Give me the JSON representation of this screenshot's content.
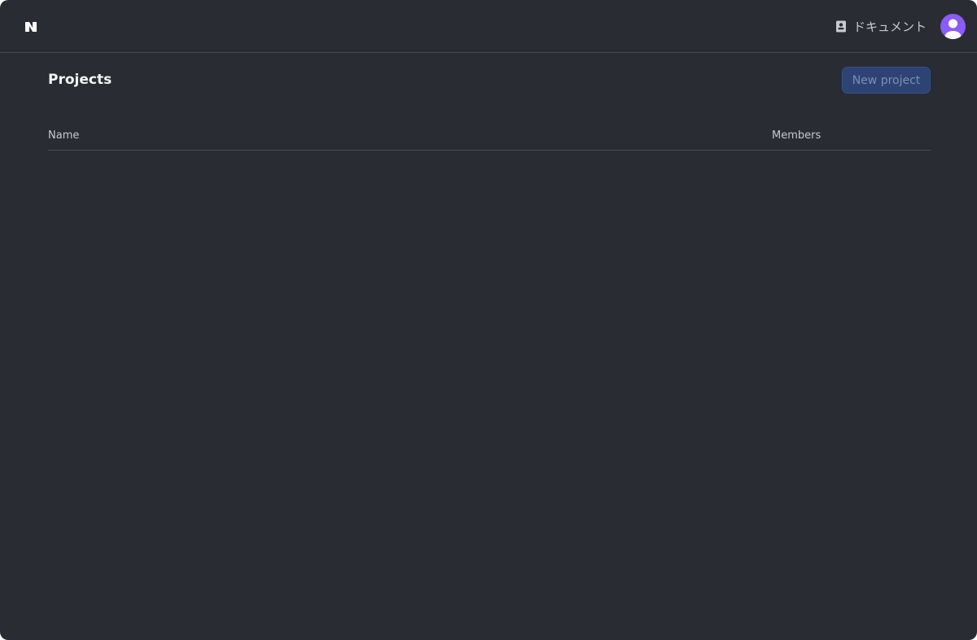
{
  "header": {
    "docs_label": "ドキュメント"
  },
  "page": {
    "title": "Projects",
    "new_project_label": "New project"
  },
  "table": {
    "columns": [
      "Name",
      "Members"
    ],
    "rows": []
  },
  "colors": {
    "background": "#292c33",
    "accent_button": "#2d4373",
    "avatar": "#8b5cf6",
    "text_primary": "#f3f4f6",
    "text_secondary": "#c7cad1"
  },
  "icons": {
    "logo": "app-logo-icon",
    "docs": "book-icon",
    "avatar": "user-avatar-icon"
  }
}
